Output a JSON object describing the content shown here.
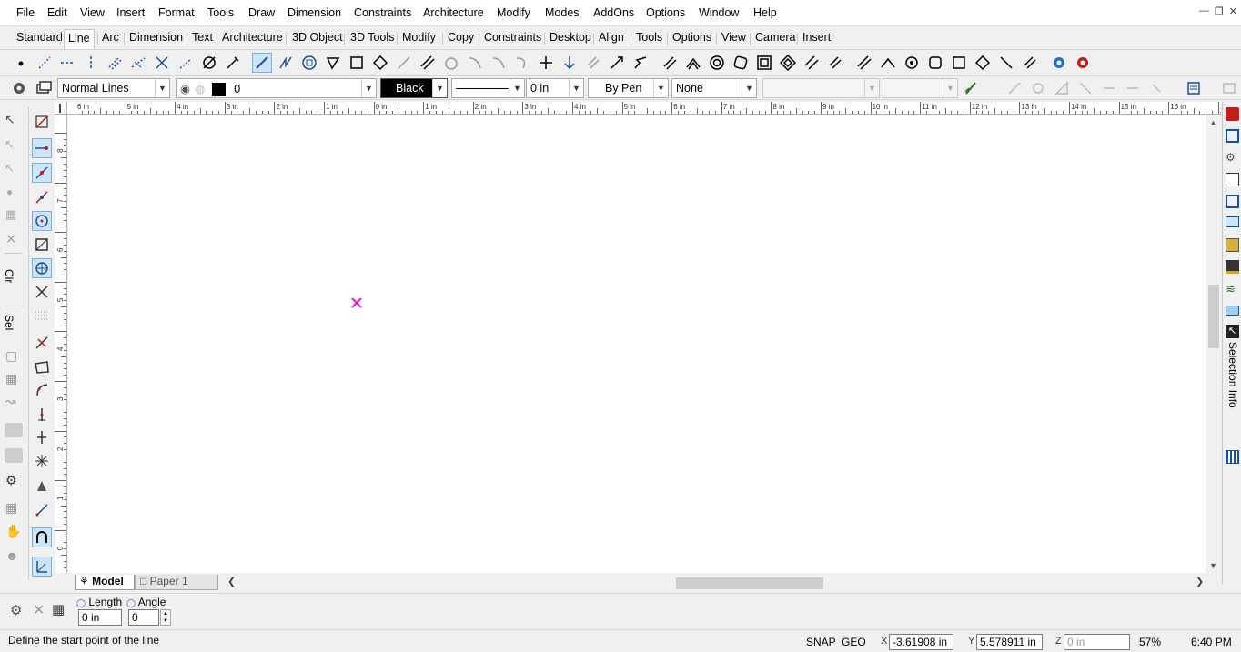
{
  "menu": [
    "File",
    "Edit",
    "View",
    "Insert",
    "Format",
    "Tools",
    "Draw",
    "Dimension",
    "Constraints",
    "Architecture",
    "Modify",
    "Modes",
    "AddOns",
    "Options",
    "Window",
    "Help"
  ],
  "tabs": [
    "Standard",
    "Line",
    "Arc",
    "Dimension",
    "Text",
    "Architecture",
    "3D Object",
    "3D Tools",
    "Modify",
    "Copy",
    "Constraints",
    "Desktop",
    "Align",
    "Tools",
    "Options",
    "View",
    "Camera",
    "Insert"
  ],
  "active_tab": "Line",
  "properties": {
    "layer": "Normal Lines",
    "layer_number": "0",
    "color": "Black",
    "line_width": "0 in",
    "pen": "By Pen",
    "fill": "None"
  },
  "ruler": {
    "h_labels": [
      "6 in",
      "5 in",
      "4 in",
      "3 in",
      "2 in",
      "1 in",
      "0 in",
      "1 in",
      "2 in",
      "3 in",
      "4 in",
      "5 in",
      "6 in",
      "7 in",
      "8 in",
      "9 in",
      "10 in",
      "11 in",
      "12 in",
      "13 in",
      "14 in",
      "15 in",
      "16 in",
      "17 i"
    ],
    "v_labels": [
      "8 in",
      "7 in",
      "6 in",
      "5 in",
      "4 in",
      "3 in",
      "2 in",
      "1 in",
      "0 in"
    ]
  },
  "left_labels": {
    "clr": "Clr",
    "sel": "Sel"
  },
  "right_panel_label": "Selection Info",
  "sheet_tabs": {
    "model": "Model",
    "paper": "Paper 1"
  },
  "inputs": {
    "length_label": "Length",
    "length_value": "0 in",
    "angle_label": "Angle",
    "angle_value": "0"
  },
  "status": {
    "message": "Define the start point of the line",
    "snap": "SNAP",
    "geo": "GEO",
    "x_label": "X",
    "x_value": "-3.61908 in",
    "y_label": "Y",
    "y_value": "5.578911 in",
    "z_label": "Z",
    "z_placeholder": "0 in",
    "zoom": "57%",
    "time": "6:40 PM"
  },
  "colors": {
    "accent": "#cce4f7",
    "cursor": "#e01ad0",
    "icon_blue": "#1a4f9c"
  }
}
